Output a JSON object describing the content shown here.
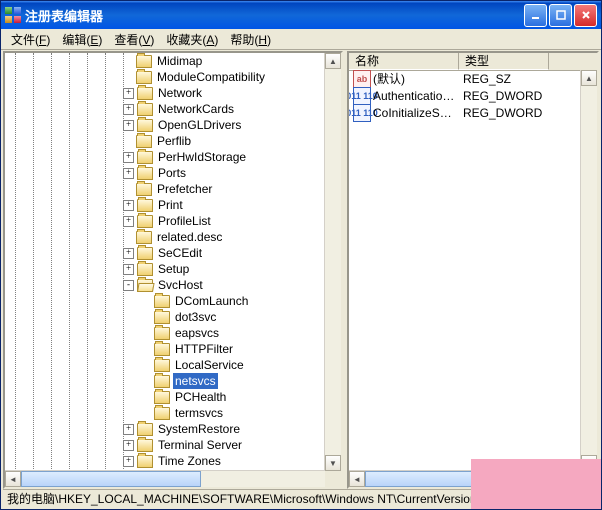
{
  "window": {
    "title": "注册表编辑器"
  },
  "menu": [
    {
      "label": "文件",
      "hotkey": "F"
    },
    {
      "label": "编辑",
      "hotkey": "E"
    },
    {
      "label": "查看",
      "hotkey": "V"
    },
    {
      "label": "收藏夹",
      "hotkey": "A"
    },
    {
      "label": "帮助",
      "hotkey": "H"
    }
  ],
  "tree": [
    {
      "depth": 7,
      "pm": "",
      "label": "Midimap"
    },
    {
      "depth": 7,
      "pm": "",
      "label": "ModuleCompatibility"
    },
    {
      "depth": 7,
      "pm": "+",
      "label": "Network"
    },
    {
      "depth": 7,
      "pm": "+",
      "label": "NetworkCards"
    },
    {
      "depth": 7,
      "pm": "+",
      "label": "OpenGLDrivers"
    },
    {
      "depth": 7,
      "pm": "",
      "label": "Perflib"
    },
    {
      "depth": 7,
      "pm": "+",
      "label": "PerHwIdStorage"
    },
    {
      "depth": 7,
      "pm": "+",
      "label": "Ports"
    },
    {
      "depth": 7,
      "pm": "",
      "label": "Prefetcher"
    },
    {
      "depth": 7,
      "pm": "+",
      "label": "Print"
    },
    {
      "depth": 7,
      "pm": "+",
      "label": "ProfileList"
    },
    {
      "depth": 7,
      "pm": "",
      "label": "related.desc"
    },
    {
      "depth": 7,
      "pm": "+",
      "label": "SeCEdit"
    },
    {
      "depth": 7,
      "pm": "+",
      "label": "Setup"
    },
    {
      "depth": 7,
      "pm": "-",
      "label": "SvcHost",
      "open": true
    },
    {
      "depth": 8,
      "pm": "",
      "label": "DComLaunch"
    },
    {
      "depth": 8,
      "pm": "",
      "label": "dot3svc"
    },
    {
      "depth": 8,
      "pm": "",
      "label": "eapsvcs"
    },
    {
      "depth": 8,
      "pm": "",
      "label": "HTTPFilter"
    },
    {
      "depth": 8,
      "pm": "",
      "label": "LocalService"
    },
    {
      "depth": 8,
      "pm": "",
      "label": "netsvcs",
      "selected": true
    },
    {
      "depth": 8,
      "pm": "",
      "label": "PCHealth"
    },
    {
      "depth": 8,
      "pm": "",
      "label": "termsvcs"
    },
    {
      "depth": 7,
      "pm": "+",
      "label": "SystemRestore"
    },
    {
      "depth": 7,
      "pm": "+",
      "label": "Terminal Server"
    },
    {
      "depth": 7,
      "pm": "+",
      "label": "Time Zones"
    }
  ],
  "list": {
    "columns": [
      {
        "label": "名称",
        "width": 110
      },
      {
        "label": "类型",
        "width": 90
      }
    ],
    "rows": [
      {
        "icon": "sz",
        "name": "(默认)",
        "type": "REG_SZ"
      },
      {
        "icon": "dw",
        "name": "Authenticatio…",
        "type": "REG_DWORD"
      },
      {
        "icon": "dw",
        "name": "CoInitializeS…",
        "type": "REG_DWORD"
      }
    ]
  },
  "status": "我的电脑\\HKEY_LOCAL_MACHINE\\SOFTWARE\\Microsoft\\Windows NT\\CurrentVersion\\",
  "icons": {
    "sz_text": "ab",
    "dw_text": "011 110"
  }
}
